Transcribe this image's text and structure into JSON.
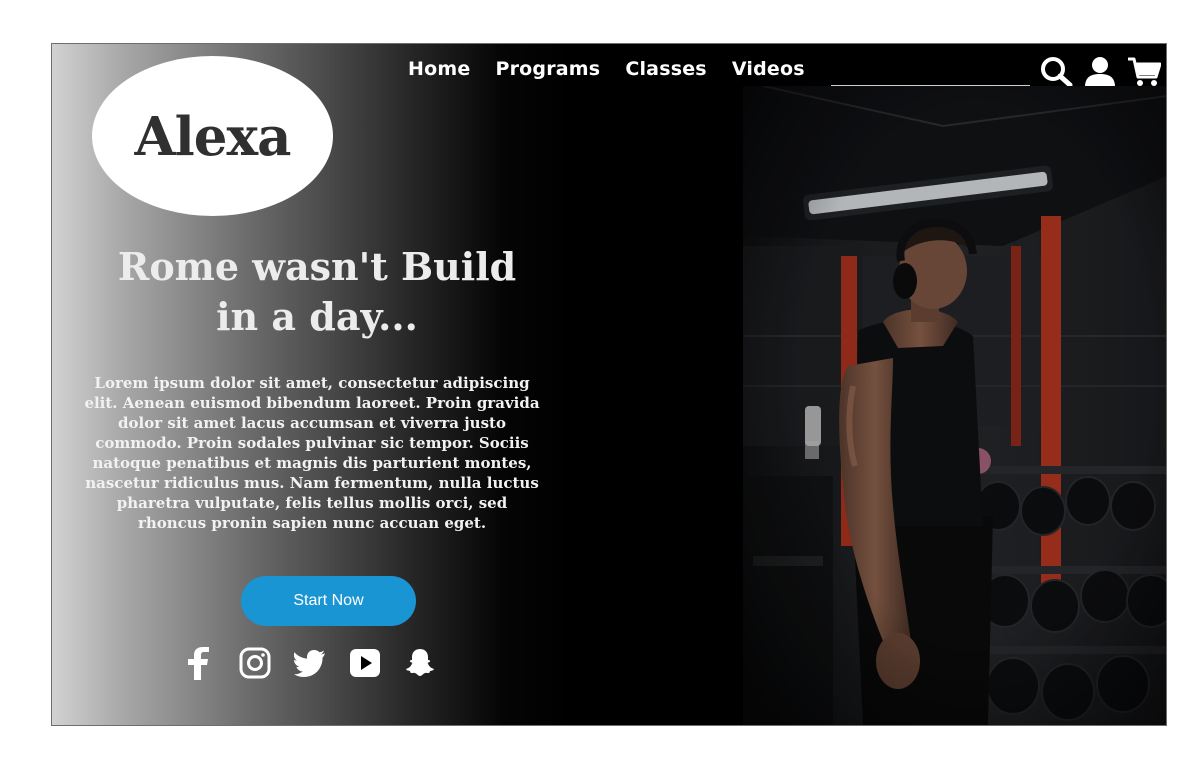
{
  "brand": {
    "logo_text": "Alexa"
  },
  "nav": {
    "items": [
      {
        "label": "Home"
      },
      {
        "label": "Programs"
      },
      {
        "label": "Classes"
      },
      {
        "label": "Videos"
      }
    ],
    "search_value": "",
    "icons": [
      "search-icon",
      "user-icon",
      "cart-icon"
    ]
  },
  "hero": {
    "headline_line1": "Rome wasn't Build",
    "headline_line2": "in a day...",
    "body": "Lorem ipsum dolor sit amet, consectetur adipiscing elit. Aenean euismod bibendum laoreet. Proin gravida dolor sit amet lacus accumsan et viverra justo commodo. Proin sodales pulvinar sic tempor. Sociis natoque penatibus et magnis dis parturient montes, nascetur ridiculus mus. Nam fermentum, nulla luctus pharetra vulputate, felis tellus mollis orci, sed rhoncus pronin sapien nunc accuan eget.",
    "cta_label": "Start Now",
    "image": "gym-athlete-photo"
  },
  "social": [
    "facebook-icon",
    "instagram-icon",
    "twitter-icon",
    "youtube-icon",
    "snapchat-icon"
  ],
  "colors": {
    "accent": "#1a95d4",
    "background": "#000000",
    "logo_bg": "#ffffff",
    "text": "#ffffff"
  }
}
